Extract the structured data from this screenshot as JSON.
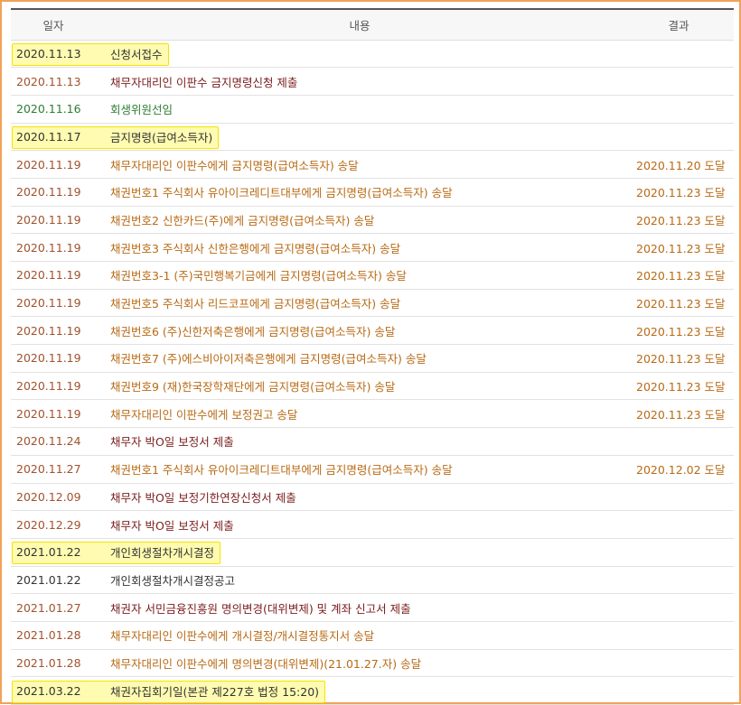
{
  "headers": {
    "date": "일자",
    "content": "내용",
    "result": "결과"
  },
  "rows": [
    {
      "date": "2020.11.13",
      "content": "신청서접수",
      "result": "",
      "kind": "black",
      "highlight": true
    },
    {
      "date": "2020.11.13",
      "content": "채무자대리인 이판수 금지명령신청 제출",
      "result": "",
      "kind": "maroon",
      "highlight": false
    },
    {
      "date": "2020.11.16",
      "content": "회생위원선임",
      "result": "",
      "kind": "green",
      "highlight": false
    },
    {
      "date": "2020.11.17",
      "content": "금지명령(급여소득자)",
      "result": "",
      "kind": "black",
      "highlight": true
    },
    {
      "date": "2020.11.19",
      "content": "채무자대리인 이판수에게 금지명령(급여소득자) 송달",
      "result": "2020.11.20 도달",
      "kind": "orange",
      "highlight": false
    },
    {
      "date": "2020.11.19",
      "content": "채권번호1 주식회사 유아이크레디트대부에게 금지명령(급여소득자) 송달",
      "result": "2020.11.23 도달",
      "kind": "orange",
      "highlight": false
    },
    {
      "date": "2020.11.19",
      "content": "채권번호2 신한카드(주)에게 금지명령(급여소득자) 송달",
      "result": "2020.11.23 도달",
      "kind": "orange",
      "highlight": false
    },
    {
      "date": "2020.11.19",
      "content": "채권번호3 주식회사 신한은행에게 금지명령(급여소득자) 송달",
      "result": "2020.11.23 도달",
      "kind": "orange",
      "highlight": false
    },
    {
      "date": "2020.11.19",
      "content": "채권번호3-1 (주)국민행복기금에게 금지명령(급여소득자) 송달",
      "result": "2020.11.23 도달",
      "kind": "orange",
      "highlight": false
    },
    {
      "date": "2020.11.19",
      "content": "채권번호5 주식회사 리드코프에게 금지명령(급여소득자) 송달",
      "result": "2020.11.23 도달",
      "kind": "orange",
      "highlight": false
    },
    {
      "date": "2020.11.19",
      "content": "채권번호6 (주)신한저축은행에게 금지명령(급여소득자) 송달",
      "result": "2020.11.23 도달",
      "kind": "orange",
      "highlight": false
    },
    {
      "date": "2020.11.19",
      "content": "채권번호7 (주)에스비아이저축은행에게 금지명령(급여소득자) 송달",
      "result": "2020.11.23 도달",
      "kind": "orange",
      "highlight": false
    },
    {
      "date": "2020.11.19",
      "content": "채권번호9 (재)한국장학재단에게 금지명령(급여소득자) 송달",
      "result": "2020.11.23 도달",
      "kind": "orange",
      "highlight": false
    },
    {
      "date": "2020.11.19",
      "content": "채무자대리인 이판수에게 보정권고 송달",
      "result": "2020.11.23 도달",
      "kind": "orange",
      "highlight": false
    },
    {
      "date": "2020.11.24",
      "content": "채무자 박O일 보정서 제출",
      "result": "",
      "kind": "maroon",
      "highlight": false
    },
    {
      "date": "2020.11.27",
      "content": "채권번호1 주식회사 유아이크레디트대부에게 금지명령(급여소득자) 송달",
      "result": "2020.12.02 도달",
      "kind": "orange",
      "highlight": false
    },
    {
      "date": "2020.12.09",
      "content": "채무자 박O일 보정기한연장신청서 제출",
      "result": "",
      "kind": "maroon",
      "highlight": false
    },
    {
      "date": "2020.12.29",
      "content": "채무자 박O일 보정서 제출",
      "result": "",
      "kind": "maroon",
      "highlight": false
    },
    {
      "date": "2021.01.22",
      "content": "개인회생절차개시결정",
      "result": "",
      "kind": "black",
      "highlight": true
    },
    {
      "date": "2021.01.22",
      "content": "개인회생절차개시결정공고",
      "result": "",
      "kind": "black",
      "highlight": false
    },
    {
      "date": "2021.01.27",
      "content": "채권자 서민금융진흥원 명의변경(대위변제) 및 계좌 신고서 제출",
      "result": "",
      "kind": "maroon",
      "highlight": false
    },
    {
      "date": "2021.01.28",
      "content": "채무자대리인 이판수에게 개시결정/개시결정통지서 송달",
      "result": "",
      "kind": "orange",
      "highlight": false
    },
    {
      "date": "2021.01.28",
      "content": "채무자대리인 이판수에게 명의변경(대위변제)(21.01.27.자) 송달",
      "result": "",
      "kind": "orange",
      "highlight": false
    },
    {
      "date": "2021.03.22",
      "content": "채권자집회기일(본관 제227호 법정 15:20)",
      "result": "",
      "kind": "black",
      "highlight": true
    }
  ]
}
